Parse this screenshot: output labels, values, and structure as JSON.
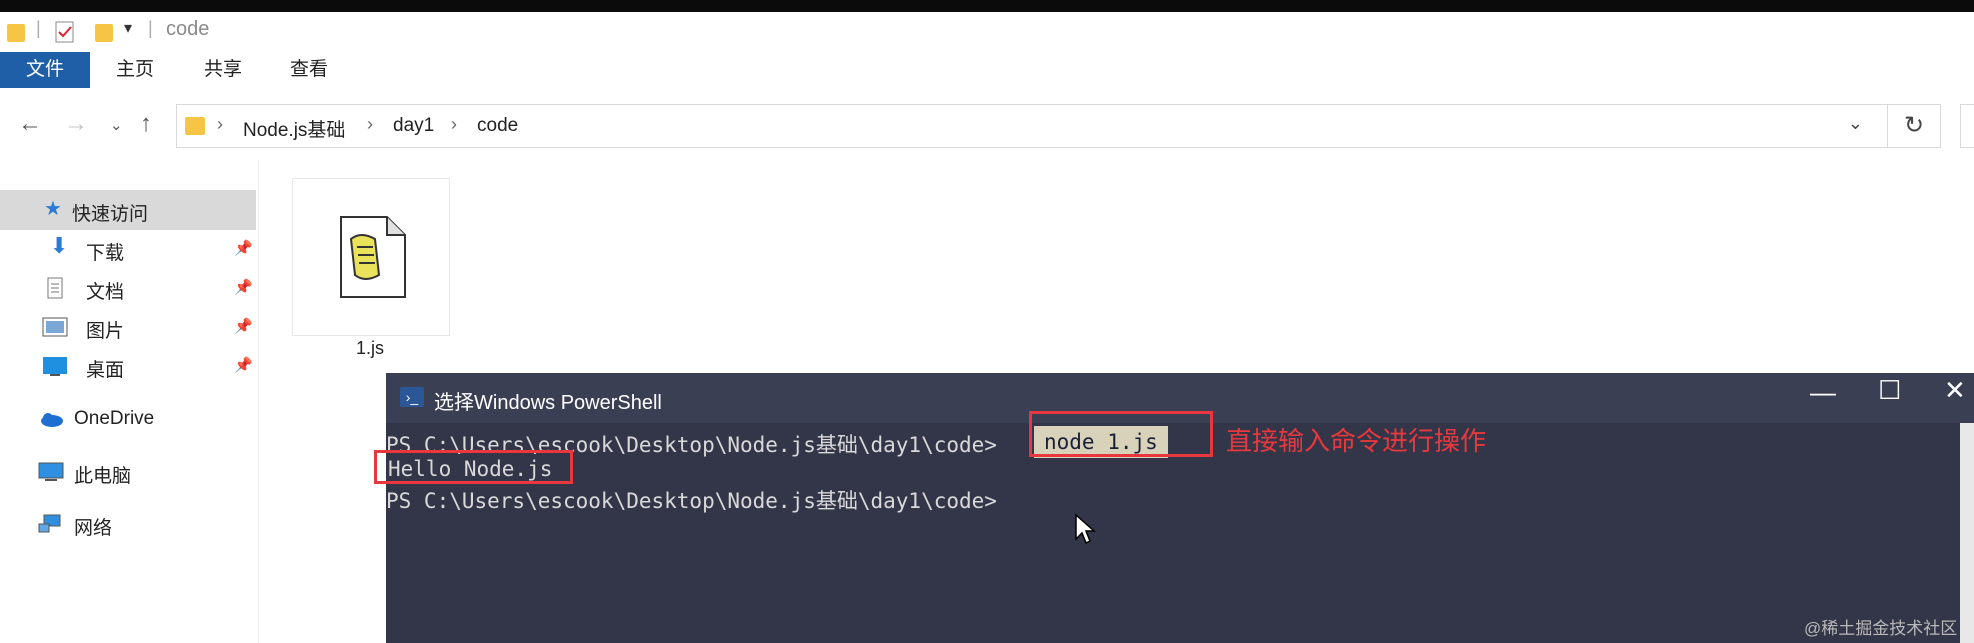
{
  "window": {
    "title": "code"
  },
  "ribbon": {
    "tabs": [
      "文件",
      "主页",
      "共享",
      "查看"
    ]
  },
  "address": {
    "crumbs": [
      "Node.js基础",
      "day1",
      "code"
    ]
  },
  "sidebar": {
    "items": [
      {
        "label": "快速访问",
        "icon": "star-icon"
      },
      {
        "label": "下载",
        "icon": "download-icon",
        "pinned": true
      },
      {
        "label": "文档",
        "icon": "document-icon",
        "pinned": true
      },
      {
        "label": "图片",
        "icon": "pictures-icon",
        "pinned": true
      },
      {
        "label": "桌面",
        "icon": "desktop-icon",
        "pinned": true
      },
      {
        "label": "OneDrive",
        "icon": "cloud-icon"
      },
      {
        "label": "此电脑",
        "icon": "computer-icon"
      },
      {
        "label": "网络",
        "icon": "network-icon"
      }
    ]
  },
  "files": [
    {
      "name": "1.js",
      "icon": "script-file-icon"
    }
  ],
  "powershell": {
    "title": "选择Windows PowerShell",
    "prompt1": "PS C:\\Users\\escook\\Desktop\\Node.js基础\\day1\\code>",
    "command": "node 1.js",
    "output": "Hello Node.js",
    "prompt2": "PS C:\\Users\\escook\\Desktop\\Node.js基础\\day1\\code>",
    "annotation": "直接输入命令进行操作"
  },
  "watermark": "@稀土掘金技术社区",
  "colors": {
    "file_tab": "#1f5fa8",
    "terminal_bg": "#323648",
    "annotation": "#e8383d"
  }
}
